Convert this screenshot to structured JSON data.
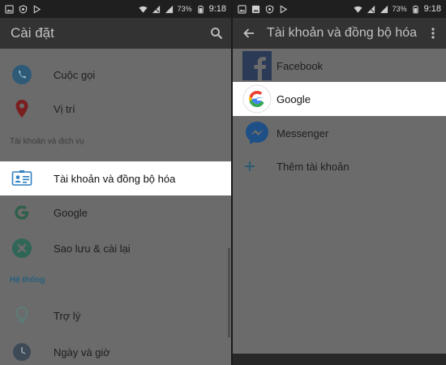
{
  "status_bar": {
    "battery": "73%",
    "time": "9:18"
  },
  "left_screen": {
    "title": "Cài đặt",
    "items": [
      {
        "label": "Cuộc gọi",
        "icon": "phone-icon"
      },
      {
        "label": "Vị trí",
        "icon": "location-pin-icon"
      }
    ],
    "section_accounts": "Tài khoản và dịch vụ",
    "account_items": [
      {
        "label": "Tài khoản và đồng bộ hóa",
        "icon": "account-card-icon"
      },
      {
        "label": "Google",
        "icon": "google-icon"
      },
      {
        "label": "Sao lưu & cài lại",
        "icon": "backup-icon"
      }
    ],
    "section_system": "Hệ thống",
    "system_items": [
      {
        "label": "Trợ lý",
        "icon": "lightbulb-icon"
      },
      {
        "label": "Ngày và giờ",
        "icon": "clock-icon"
      }
    ]
  },
  "right_screen": {
    "title": "Tài khoản và đồng bộ hóa",
    "accounts": [
      {
        "label": "Facebook",
        "icon": "facebook-icon"
      },
      {
        "label": "Google",
        "icon": "google-icon"
      },
      {
        "label": "Messenger",
        "icon": "messenger-icon"
      },
      {
        "label": "Thêm tài khoản",
        "icon": "plus-icon"
      }
    ]
  },
  "colors": {
    "dim_background": "#6b6b6b",
    "app_bar": "#333333",
    "status_bar": "#1f1f1f",
    "highlight": "#ffffff",
    "section_accent": "#26607d",
    "facebook": "#3b5998",
    "messenger": "#0084ff"
  }
}
